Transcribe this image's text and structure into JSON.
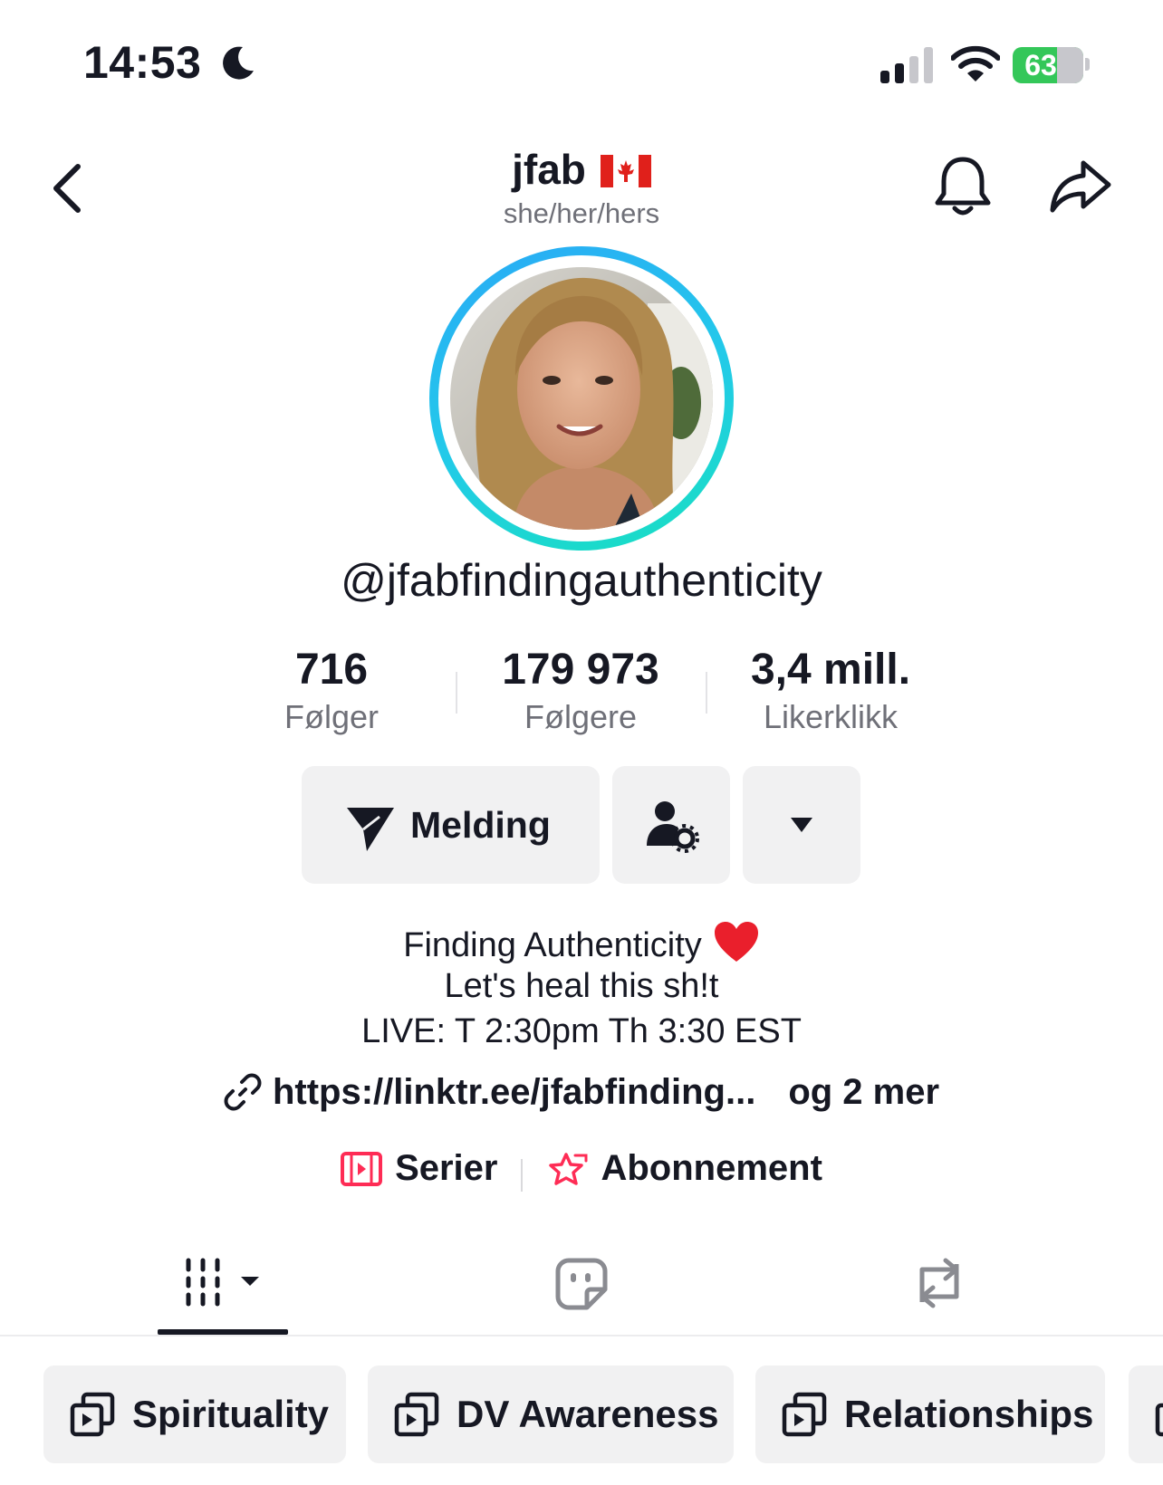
{
  "status_bar": {
    "time": "14:53",
    "battery": "63",
    "battery_level": 0.63
  },
  "header": {
    "title": "jfab",
    "pronouns": "she/her/hers"
  },
  "profile": {
    "handle": "@jfabfindingauthenticity"
  },
  "stats": [
    {
      "value": "716",
      "label": "Følger"
    },
    {
      "value": "179 973",
      "label": "Følgere"
    },
    {
      "value": "3,4 mill.",
      "label": "Likerklikk"
    }
  ],
  "actions": {
    "message_label": "Melding"
  },
  "bio": {
    "line1": "Finding Authenticity",
    "line2": "Let's heal this sh!t",
    "line3": "LIVE: T 2:30pm Th 3:30 EST"
  },
  "link": {
    "url": "https://linktr.ee/jfabfinding...",
    "more": "og 2 mer"
  },
  "features": {
    "series": "Serier",
    "subscription": "Abonnement"
  },
  "playlists": [
    {
      "label": "Spirituality"
    },
    {
      "label": "DV Awareness"
    },
    {
      "label": "Relationships"
    }
  ],
  "colors": {
    "accent": "#fe2c55",
    "ring_start": "#2aa9f6",
    "ring_end": "#18e0c0",
    "battery": "#34c759"
  },
  "icons": [
    "moon-icon",
    "signal-icon",
    "wifi-icon",
    "back-icon",
    "canada-flag-icon",
    "bell-icon",
    "share-icon",
    "send-icon",
    "add-friend-settings-icon",
    "dropdown-icon",
    "heart-icon",
    "link-icon",
    "series-icon",
    "subscription-icon",
    "videos-grid-icon",
    "liked-icon",
    "reposts-icon",
    "playlist-icon"
  ]
}
